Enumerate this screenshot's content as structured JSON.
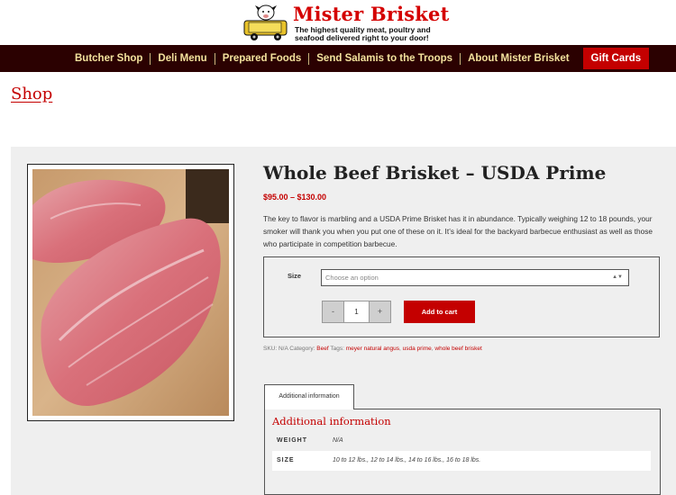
{
  "brand": {
    "name": "Mister Brisket",
    "tagline_line1": "The highest quality meat, poultry and",
    "tagline_line2": "seafood delivered right to your door!",
    "truck_text_line1": "MISTER BRISKET",
    "truck_text_line2": "MEATMOBILE"
  },
  "nav": {
    "items": [
      "Butcher Shop",
      "Deli Menu",
      "Prepared Foods",
      "Send Salamis to the Troops",
      "About Mister Brisket"
    ],
    "gift": "Gift Cards"
  },
  "page": {
    "heading": "Shop"
  },
  "product": {
    "title": "Whole Beef Brisket – USDA Prime",
    "price": "$95.00 – $130.00",
    "description": "The key to flavor is marbling and a USDA Prime Brisket has it in abundance.  Typically weighing  12 to 18 pounds, your smoker will thank you when you put one of these on it.  It’s ideal for the backyard barbecue enthusiast as well as those who participate in competition barbecue.",
    "size_label": "Size",
    "size_placeholder": "Choose an option",
    "qty_minus": "-",
    "qty_value": "1",
    "qty_plus": "+",
    "add_to_cart": "Add to cart",
    "meta": {
      "sku": "SKU: N/A",
      "category_label": "Category:",
      "category": "Beef",
      "tags_label": "Tags:",
      "tags": [
        "meyer natural angus",
        "usda prime",
        "whole beef brisket"
      ]
    }
  },
  "tabs": {
    "active": "Additional information",
    "panel_title": "Additional information",
    "rows": [
      {
        "label": "WEIGHT",
        "value": "N/A"
      },
      {
        "label": "SIZE",
        "value": "10 to 12 lbs., 12 to 14 lbs., 14 to 16 lbs., 16 to 18 lbs."
      }
    ]
  },
  "colors": {
    "accent": "#c40000",
    "nav_bg": "#2b0101",
    "nav_text": "#f3e29d"
  }
}
